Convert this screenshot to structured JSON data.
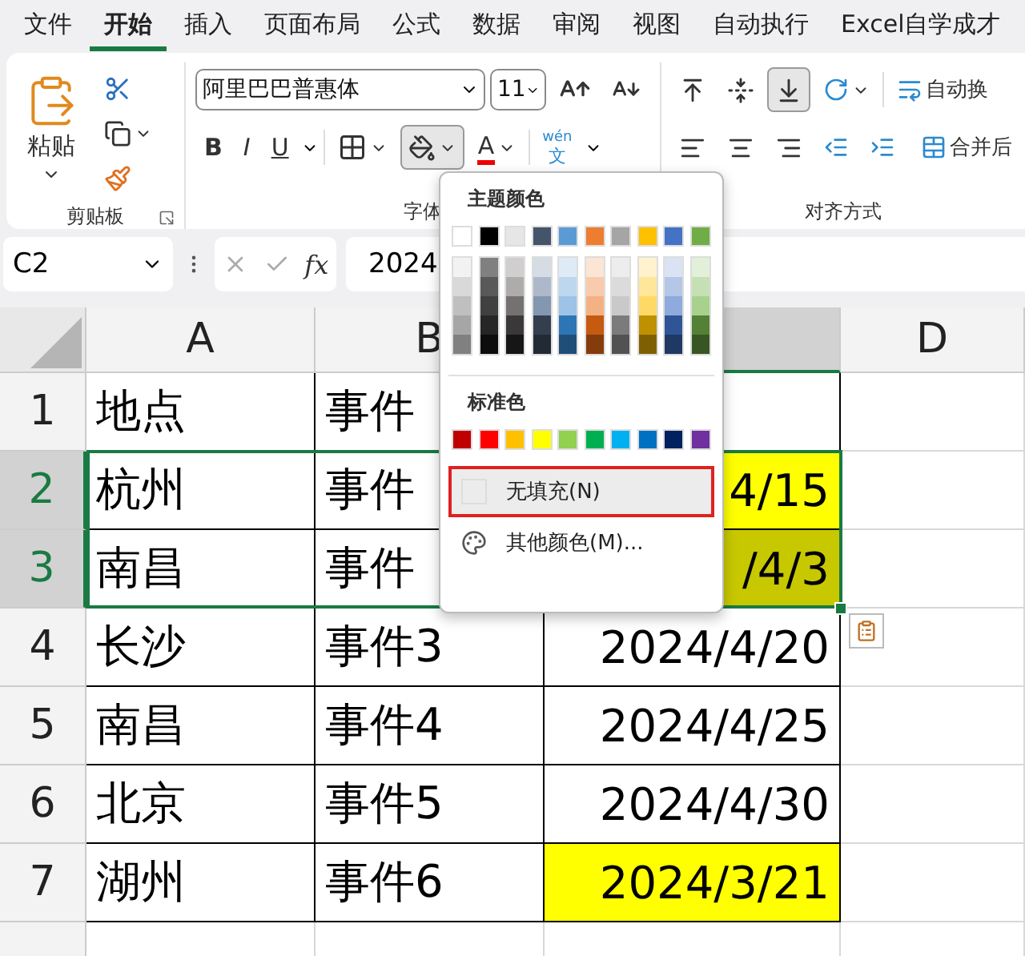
{
  "menu_tabs": [
    {
      "label": "文件",
      "selected": false
    },
    {
      "label": "开始",
      "selected": true
    },
    {
      "label": "插入",
      "selected": false
    },
    {
      "label": "页面布局",
      "selected": false
    },
    {
      "label": "公式",
      "selected": false
    },
    {
      "label": "数据",
      "selected": false
    },
    {
      "label": "审阅",
      "selected": false
    },
    {
      "label": "视图",
      "selected": false
    },
    {
      "label": "自动执行",
      "selected": false
    },
    {
      "label": "Excel自学成才",
      "selected": false
    }
  ],
  "ribbon": {
    "clipboard": {
      "paste_label": "粘贴",
      "group_label": "剪贴板"
    },
    "font": {
      "font_name": "阿里巴巴普惠体",
      "font_size": "11",
      "bold": "B",
      "italic": "I",
      "underline": "U",
      "font_color_letter": "A",
      "phonetic": "wén",
      "phonetic_char": "文",
      "fill_pressed": true,
      "group_label": "字体"
    },
    "alignment": {
      "wrap_label": "自动换",
      "merge_label": "合并后",
      "group_label": "对齐方式"
    }
  },
  "name_box": "C2",
  "fx": "fx",
  "formula": "2024",
  "columns": [
    {
      "label": "A",
      "selected": false
    },
    {
      "label": "B",
      "selected": false
    },
    {
      "selected": true
    },
    {
      "label": "D",
      "selected": false
    }
  ],
  "rows": [
    {
      "header": "1",
      "selected": false,
      "cells": [
        {
          "text": "地点"
        },
        {
          "text": "事件"
        },
        {}
      ]
    },
    {
      "header": "2",
      "selected": true,
      "cells": [
        {
          "text": "杭州"
        },
        {
          "text": "事件"
        },
        {
          "text": "4/15",
          "color": "#ffff00"
        }
      ]
    },
    {
      "header": "3",
      "selected": true,
      "cells": [
        {
          "text": "南昌"
        },
        {
          "text": "事件"
        },
        {
          "text": "/4/3",
          "color": "#c8c800"
        }
      ]
    },
    {
      "header": "4",
      "selected": false,
      "cells": [
        {
          "text": "长沙"
        },
        {
          "text": "事件3"
        },
        {
          "text": "2024/4/20"
        }
      ]
    },
    {
      "header": "5",
      "selected": false,
      "cells": [
        {
          "text": "南昌"
        },
        {
          "text": "事件4"
        },
        {
          "text": "2024/4/25"
        }
      ]
    },
    {
      "header": "6",
      "selected": false,
      "cells": [
        {
          "text": "北京"
        },
        {
          "text": "事件5"
        },
        {
          "text": "2024/4/30"
        }
      ]
    },
    {
      "header": "7",
      "selected": false,
      "cells": [
        {
          "text": "湖州"
        },
        {
          "text": "事件6"
        },
        {
          "text": "2024/3/21",
          "color": "#ffff00"
        }
      ]
    },
    {
      "selected": false,
      "cells": [
        {},
        {},
        {}
      ]
    }
  ],
  "dropdown": {
    "theme_title": "主题颜色",
    "theme_colors": [
      {
        "color": "#ffffff",
        "shades": [
          {
            "color": "#f2f2f2"
          },
          {
            "color": "#d9d9d9"
          },
          {
            "color": "#bfbfbf"
          },
          {
            "color": "#a6a6a6"
          },
          {
            "color": "#808080"
          }
        ]
      },
      {
        "color": "#000000",
        "shades": [
          {
            "color": "#808080"
          },
          {
            "color": "#595959"
          },
          {
            "color": "#404040"
          },
          {
            "color": "#262626"
          },
          {
            "color": "#0d0d0d"
          }
        ]
      },
      {
        "color": "#e7e6e6",
        "shades": [
          {
            "color": "#d0cece"
          },
          {
            "color": "#aeabab"
          },
          {
            "color": "#757171"
          },
          {
            "color": "#3a3838"
          },
          {
            "color": "#171616"
          }
        ]
      },
      {
        "color": "#44546a",
        "shades": [
          {
            "color": "#d6dce4"
          },
          {
            "color": "#adb9ca"
          },
          {
            "color": "#8497b0"
          },
          {
            "color": "#333f4f"
          },
          {
            "color": "#222a35"
          }
        ]
      },
      {
        "color": "#5b9bd5",
        "shades": [
          {
            "color": "#deebf6"
          },
          {
            "color": "#bdd7ee"
          },
          {
            "color": "#9dc3e6"
          },
          {
            "color": "#2e75b5"
          },
          {
            "color": "#1f4e79"
          }
        ]
      },
      {
        "color": "#ed7d31",
        "shades": [
          {
            "color": "#fbe5d5"
          },
          {
            "color": "#f8cbad"
          },
          {
            "color": "#f4b183"
          },
          {
            "color": "#c55a11"
          },
          {
            "color": "#843c0b"
          }
        ]
      },
      {
        "color": "#a5a5a5",
        "shades": [
          {
            "color": "#ededed"
          },
          {
            "color": "#dbdbdb"
          },
          {
            "color": "#c9c9c9"
          },
          {
            "color": "#7b7b7b"
          },
          {
            "color": "#525252"
          }
        ]
      },
      {
        "color": "#ffc000",
        "shades": [
          {
            "color": "#fff2cc"
          },
          {
            "color": "#ffe699"
          },
          {
            "color": "#ffd966"
          },
          {
            "color": "#bf9000"
          },
          {
            "color": "#7f6000"
          }
        ]
      },
      {
        "color": "#4472c4",
        "shades": [
          {
            "color": "#dae3f3"
          },
          {
            "color": "#b4c7e7"
          },
          {
            "color": "#8faadc"
          },
          {
            "color": "#2f5597"
          },
          {
            "color": "#1f3864"
          }
        ]
      },
      {
        "color": "#70ad47",
        "shades": [
          {
            "color": "#e2efd9"
          },
          {
            "color": "#c5e0b4"
          },
          {
            "color": "#a9d18e"
          },
          {
            "color": "#538135"
          },
          {
            "color": "#375623"
          }
        ]
      }
    ],
    "standard_title": "标准色",
    "standard_colors": [
      {
        "color": "#c00000"
      },
      {
        "color": "#ff0000"
      },
      {
        "color": "#ffc000"
      },
      {
        "color": "#ffff00"
      },
      {
        "color": "#92d050"
      },
      {
        "color": "#00b050"
      },
      {
        "color": "#00b0f0"
      },
      {
        "color": "#0070c0"
      },
      {
        "color": "#002060"
      },
      {
        "color": "#7030a0"
      }
    ],
    "no_fill": {
      "label": "无填充(N)",
      "highlighted": true
    },
    "more_colors": "其他颜色(M)..."
  }
}
